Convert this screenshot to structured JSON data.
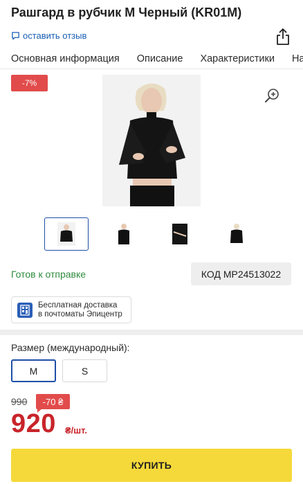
{
  "product": {
    "title": "Рашгард в рубчик M Черный (KR01M)",
    "review_link": "оставить отзыв"
  },
  "tabs": [
    {
      "label": "Основная информация"
    },
    {
      "label": "Описание"
    },
    {
      "label": "Характеристики"
    },
    {
      "label": "Напи"
    }
  ],
  "gallery": {
    "discount_badge": "-7%",
    "thumbnail_count": 4,
    "active_thumbnail": 0
  },
  "availability": {
    "status": "Готов к отправке",
    "code": "КОД MP24513022"
  },
  "delivery": {
    "line1": "Бесплатная доставка",
    "line2": "в почтоматы Эпицентр"
  },
  "size": {
    "label": "Размер (международный):",
    "options": [
      {
        "label": "M",
        "selected": true
      },
      {
        "label": "S",
        "selected": false
      }
    ]
  },
  "price": {
    "old": "990",
    "saving": "-70 ₴",
    "current": "920",
    "unit": "₴/шт."
  },
  "actions": {
    "buy_label": "КУПИТЬ"
  },
  "colors": {
    "accent_blue": "#1d4fa8",
    "sale_red": "#e24b4b",
    "price_red": "#c8242a",
    "stock_green": "#2e8b3e",
    "buy_yellow": "#f5d93a"
  },
  "icons": {
    "review": "comment-icon",
    "share": "share-icon",
    "zoom": "zoom-in-icon",
    "delivery": "parcel-locker-icon"
  }
}
